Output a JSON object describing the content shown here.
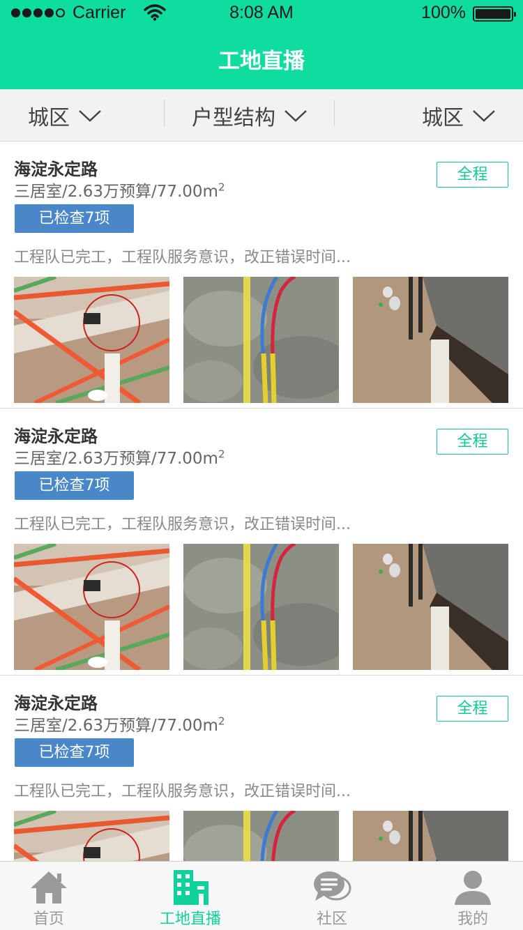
{
  "status_bar": {
    "carrier": "Carrier",
    "time": "8:08 AM",
    "battery": "100%",
    "signal_bars_filled": 4,
    "signal_bars_total": 5
  },
  "header": {
    "title": "工地直播",
    "color": "#0fdc9f"
  },
  "filters": [
    {
      "label": "城区"
    },
    {
      "label": "户型结构"
    },
    {
      "label": "城区"
    }
  ],
  "cards": [
    {
      "name": "海淀永定路",
      "info": "三居室/2.63万预算/77.00m",
      "info_sup": "2",
      "badge": "已检查7项",
      "stage": "全程",
      "desc": "工程队已完工，工程队服务意识，改正错误时间...",
      "photos": [
        "pipe-photo",
        "wire-photo",
        "drain-photo"
      ]
    },
    {
      "name": "海淀永定路",
      "info": "三居室/2.63万预算/77.00m",
      "info_sup": "2",
      "badge": "已检查7项",
      "stage": "全程",
      "desc": "工程队已完工，工程队服务意识，改正错误时间...",
      "photos": [
        "pipe-photo",
        "wire-photo",
        "drain-photo"
      ]
    },
    {
      "name": "海淀永定路",
      "info": "三居室/2.63万预算/77.00m",
      "info_sup": "2",
      "badge": "已检查7项",
      "stage": "全程",
      "desc": "工程队已完工，工程队服务意识，改正错误时间...",
      "photos": [
        "pipe-photo",
        "wire-photo",
        "drain-photo"
      ]
    }
  ],
  "tabbar": {
    "active_color": "#0fd19a",
    "items": [
      {
        "label": "首页",
        "icon": "home-icon"
      },
      {
        "label": "工地直播",
        "icon": "building-icon"
      },
      {
        "label": "社区",
        "icon": "chat-bubbles-icon"
      },
      {
        "label": "我的",
        "icon": "person-icon"
      }
    ]
  }
}
